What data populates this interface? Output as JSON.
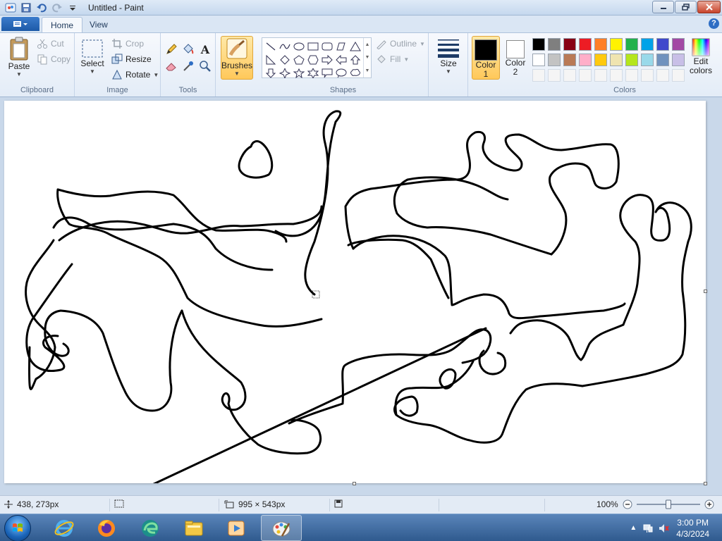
{
  "window": {
    "title": "Untitled - Paint"
  },
  "tabs": [
    {
      "label": "Home",
      "active": true
    },
    {
      "label": "View",
      "active": false
    }
  ],
  "help_label": "?",
  "ribbon": {
    "clipboard": {
      "label": "Clipboard",
      "paste": "Paste",
      "cut": "Cut",
      "copy": "Copy"
    },
    "image": {
      "label": "Image",
      "select": "Select",
      "crop": "Crop",
      "resize": "Resize",
      "rotate": "Rotate"
    },
    "tools": {
      "label": "Tools",
      "text_glyph": "A"
    },
    "brushes": {
      "label": "Brushes"
    },
    "shapes": {
      "label": "Shapes",
      "outline": "Outline",
      "fill": "Fill"
    },
    "size": {
      "label": "Size"
    },
    "color1": {
      "label_line1": "Color",
      "label_line2": "1",
      "value": "#000000"
    },
    "color2": {
      "label_line1": "Color",
      "label_line2": "2",
      "value": "#ffffff"
    },
    "colors": {
      "label": "Colors",
      "edit_line1": "Edit",
      "edit_line2": "colors",
      "row1": [
        "#000000",
        "#7f7f7f",
        "#880015",
        "#ed1c24",
        "#ff7f27",
        "#fff200",
        "#22b14c",
        "#00a2e8",
        "#3f48cc",
        "#a349a4"
      ],
      "row2": [
        "#ffffff",
        "#c3c3c3",
        "#b97a57",
        "#ffaec9",
        "#ffc90e",
        "#efe4b0",
        "#b5e61d",
        "#99d9ea",
        "#7092be",
        "#c8bfe7"
      ],
      "row3": [
        "#f5f5f5",
        "#f5f5f5",
        "#f5f5f5",
        "#f5f5f5",
        "#f5f5f5",
        "#f5f5f5",
        "#f5f5f5",
        "#f5f5f5",
        "#f5f5f5",
        "#f5f5f5"
      ]
    }
  },
  "status": {
    "cursor_pos": "438, 273px",
    "canvas_size": "995 × 543px",
    "zoom": "100%",
    "zoom_fraction": 0.5
  },
  "taskbar": {
    "clock_time": "3:00 PM",
    "clock_date": "4/3/2024"
  },
  "icons": {
    "save": "save-icon",
    "undo": "undo-icon",
    "redo": "redo-icon",
    "paste": "clipboard-icon",
    "cut": "scissors-icon",
    "copy": "copy-icon",
    "pencil": "pencil-icon",
    "fill": "paint-bucket-icon",
    "text": "text-icon",
    "eraser": "eraser-icon",
    "picker": "color-picker-icon",
    "magnifier": "magnifier-icon"
  }
}
